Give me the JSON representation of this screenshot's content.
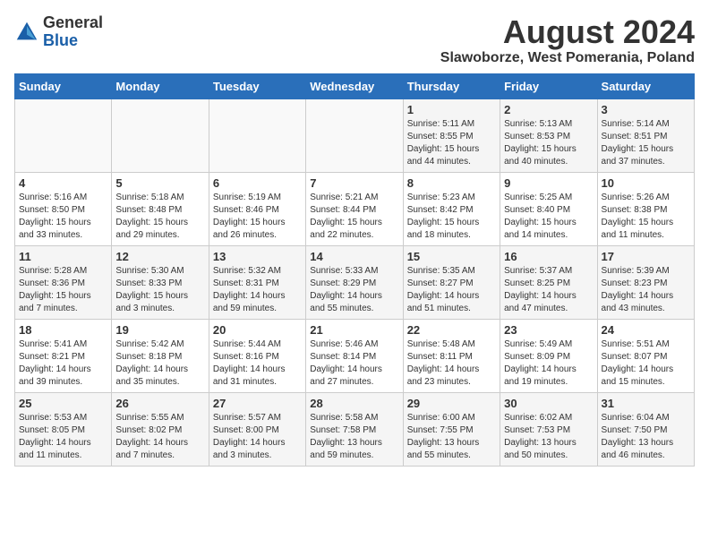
{
  "header": {
    "logo_general": "General",
    "logo_blue": "Blue",
    "title": "August 2024",
    "subtitle": "Slawoborze, West Pomerania, Poland"
  },
  "calendar": {
    "days_of_week": [
      "Sunday",
      "Monday",
      "Tuesday",
      "Wednesday",
      "Thursday",
      "Friday",
      "Saturday"
    ],
    "weeks": [
      [
        {
          "day": "",
          "info": ""
        },
        {
          "day": "",
          "info": ""
        },
        {
          "day": "",
          "info": ""
        },
        {
          "day": "",
          "info": ""
        },
        {
          "day": "1",
          "info": "Sunrise: 5:11 AM\nSunset: 8:55 PM\nDaylight: 15 hours\nand 44 minutes."
        },
        {
          "day": "2",
          "info": "Sunrise: 5:13 AM\nSunset: 8:53 PM\nDaylight: 15 hours\nand 40 minutes."
        },
        {
          "day": "3",
          "info": "Sunrise: 5:14 AM\nSunset: 8:51 PM\nDaylight: 15 hours\nand 37 minutes."
        }
      ],
      [
        {
          "day": "4",
          "info": "Sunrise: 5:16 AM\nSunset: 8:50 PM\nDaylight: 15 hours\nand 33 minutes."
        },
        {
          "day": "5",
          "info": "Sunrise: 5:18 AM\nSunset: 8:48 PM\nDaylight: 15 hours\nand 29 minutes."
        },
        {
          "day": "6",
          "info": "Sunrise: 5:19 AM\nSunset: 8:46 PM\nDaylight: 15 hours\nand 26 minutes."
        },
        {
          "day": "7",
          "info": "Sunrise: 5:21 AM\nSunset: 8:44 PM\nDaylight: 15 hours\nand 22 minutes."
        },
        {
          "day": "8",
          "info": "Sunrise: 5:23 AM\nSunset: 8:42 PM\nDaylight: 15 hours\nand 18 minutes."
        },
        {
          "day": "9",
          "info": "Sunrise: 5:25 AM\nSunset: 8:40 PM\nDaylight: 15 hours\nand 14 minutes."
        },
        {
          "day": "10",
          "info": "Sunrise: 5:26 AM\nSunset: 8:38 PM\nDaylight: 15 hours\nand 11 minutes."
        }
      ],
      [
        {
          "day": "11",
          "info": "Sunrise: 5:28 AM\nSunset: 8:36 PM\nDaylight: 15 hours\nand 7 minutes."
        },
        {
          "day": "12",
          "info": "Sunrise: 5:30 AM\nSunset: 8:33 PM\nDaylight: 15 hours\nand 3 minutes."
        },
        {
          "day": "13",
          "info": "Sunrise: 5:32 AM\nSunset: 8:31 PM\nDaylight: 14 hours\nand 59 minutes."
        },
        {
          "day": "14",
          "info": "Sunrise: 5:33 AM\nSunset: 8:29 PM\nDaylight: 14 hours\nand 55 minutes."
        },
        {
          "day": "15",
          "info": "Sunrise: 5:35 AM\nSunset: 8:27 PM\nDaylight: 14 hours\nand 51 minutes."
        },
        {
          "day": "16",
          "info": "Sunrise: 5:37 AM\nSunset: 8:25 PM\nDaylight: 14 hours\nand 47 minutes."
        },
        {
          "day": "17",
          "info": "Sunrise: 5:39 AM\nSunset: 8:23 PM\nDaylight: 14 hours\nand 43 minutes."
        }
      ],
      [
        {
          "day": "18",
          "info": "Sunrise: 5:41 AM\nSunset: 8:21 PM\nDaylight: 14 hours\nand 39 minutes."
        },
        {
          "day": "19",
          "info": "Sunrise: 5:42 AM\nSunset: 8:18 PM\nDaylight: 14 hours\nand 35 minutes."
        },
        {
          "day": "20",
          "info": "Sunrise: 5:44 AM\nSunset: 8:16 PM\nDaylight: 14 hours\nand 31 minutes."
        },
        {
          "day": "21",
          "info": "Sunrise: 5:46 AM\nSunset: 8:14 PM\nDaylight: 14 hours\nand 27 minutes."
        },
        {
          "day": "22",
          "info": "Sunrise: 5:48 AM\nSunset: 8:11 PM\nDaylight: 14 hours\nand 23 minutes."
        },
        {
          "day": "23",
          "info": "Sunrise: 5:49 AM\nSunset: 8:09 PM\nDaylight: 14 hours\nand 19 minutes."
        },
        {
          "day": "24",
          "info": "Sunrise: 5:51 AM\nSunset: 8:07 PM\nDaylight: 14 hours\nand 15 minutes."
        }
      ],
      [
        {
          "day": "25",
          "info": "Sunrise: 5:53 AM\nSunset: 8:05 PM\nDaylight: 14 hours\nand 11 minutes."
        },
        {
          "day": "26",
          "info": "Sunrise: 5:55 AM\nSunset: 8:02 PM\nDaylight: 14 hours\nand 7 minutes."
        },
        {
          "day": "27",
          "info": "Sunrise: 5:57 AM\nSunset: 8:00 PM\nDaylight: 14 hours\nand 3 minutes."
        },
        {
          "day": "28",
          "info": "Sunrise: 5:58 AM\nSunset: 7:58 PM\nDaylight: 13 hours\nand 59 minutes."
        },
        {
          "day": "29",
          "info": "Sunrise: 6:00 AM\nSunset: 7:55 PM\nDaylight: 13 hours\nand 55 minutes."
        },
        {
          "day": "30",
          "info": "Sunrise: 6:02 AM\nSunset: 7:53 PM\nDaylight: 13 hours\nand 50 minutes."
        },
        {
          "day": "31",
          "info": "Sunrise: 6:04 AM\nSunset: 7:50 PM\nDaylight: 13 hours\nand 46 minutes."
        }
      ]
    ]
  }
}
